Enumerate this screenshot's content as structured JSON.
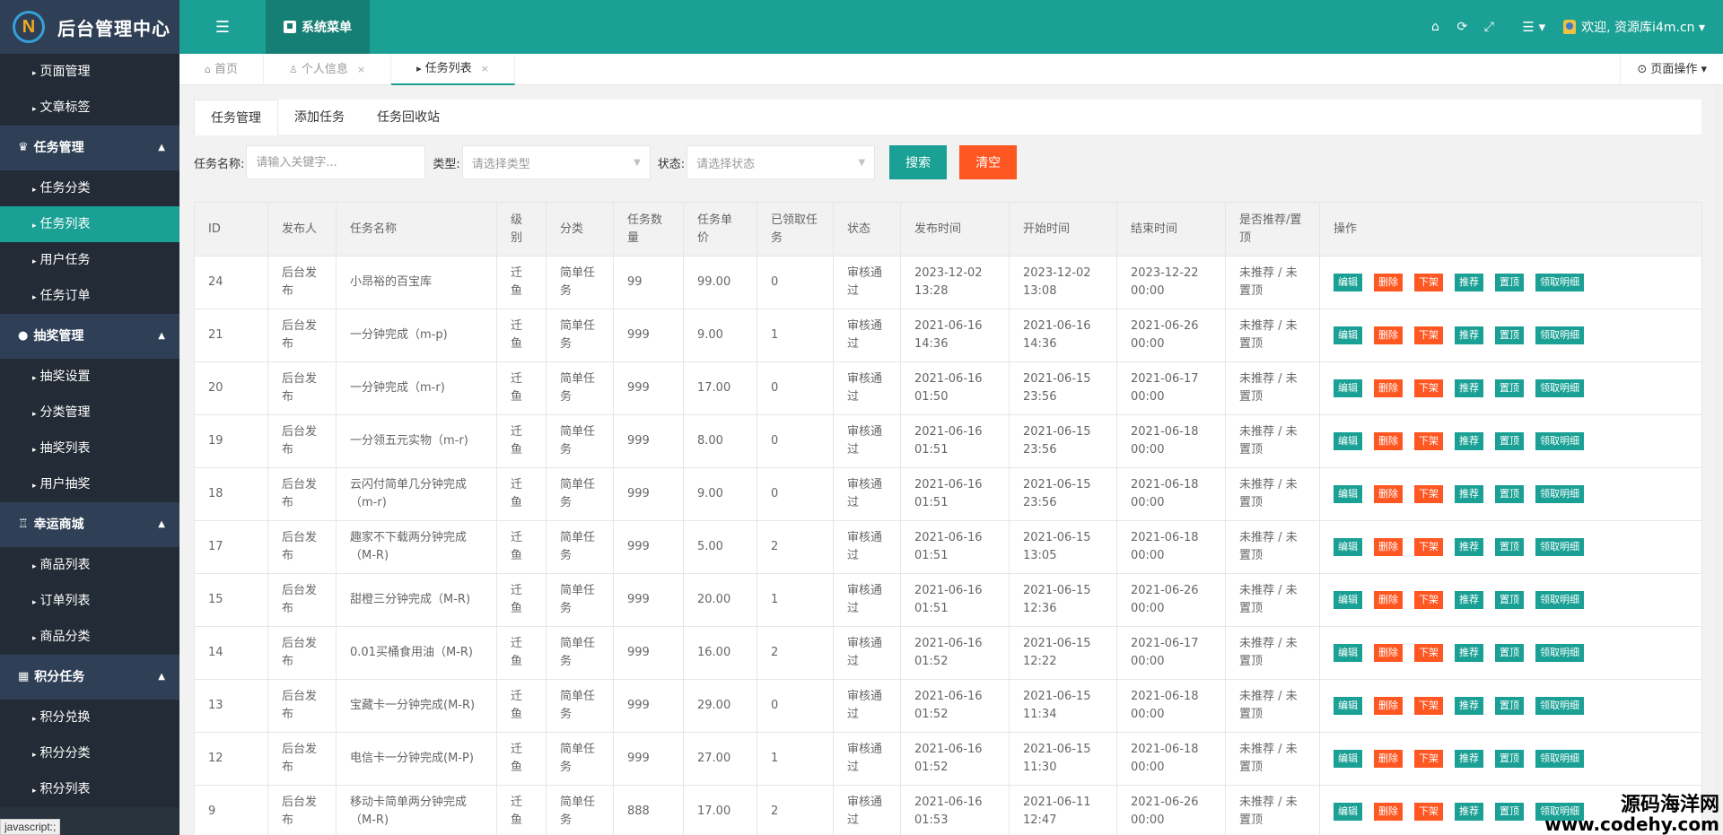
{
  "header": {
    "logo_letter": "N",
    "title": "后台管理中心",
    "menu_toggle": "☰",
    "system_menu": "系统菜单",
    "home_icon": "⌂",
    "refresh_icon": "⟳",
    "fullscreen_icon": "⤢",
    "list_icon": "☰ ▾",
    "user": "欢迎, 资源库i4m.cn ▾"
  },
  "sidebar": {
    "top_items": [
      "页面管理",
      "文章标签"
    ],
    "groups": [
      {
        "icon": "♛",
        "label": "任务管理",
        "items": [
          "任务分类",
          "任务列表",
          "用户任务",
          "任务订单"
        ],
        "active": 1
      },
      {
        "icon": "●",
        "label": "抽奖管理",
        "items": [
          "抽奖设置",
          "分类管理",
          "抽奖列表",
          "用户抽奖"
        ]
      },
      {
        "icon": "♖",
        "label": "幸运商城",
        "items": [
          "商品列表",
          "订单列表",
          "商品分类"
        ]
      },
      {
        "icon": "▦",
        "label": "积分任务",
        "items": [
          "积分兑换",
          "积分分类",
          "积分列表"
        ]
      }
    ],
    "status": "javascript:;"
  },
  "tabs": {
    "items": [
      {
        "icon": "⌂",
        "label": "首页",
        "closable": false
      },
      {
        "icon": "♙",
        "label": "个人信息",
        "closable": true
      },
      {
        "icon": "▸",
        "label": "任务列表",
        "closable": true,
        "active": true
      }
    ],
    "close": "×",
    "page_ops": "⊙ 页面操作 ▾"
  },
  "subtabs": [
    "任务管理",
    "添加任务",
    "任务回收站"
  ],
  "filter": {
    "name_label": "任务名称:",
    "name_placeholder": "请输入关键字...",
    "type_label": "类型:",
    "type_placeholder": "请选择类型",
    "status_label": "状态:",
    "status_placeholder": "请选择状态",
    "search": "搜索",
    "clear": "清空"
  },
  "table": {
    "headers": [
      "ID",
      "发布人",
      "任务名称",
      "级别",
      "分类",
      "任务数量",
      "任务单价",
      "已领取任务",
      "状态",
      "发布时间",
      "开始时间",
      "结束时间",
      "是否推荐/置顶",
      "操作"
    ],
    "rows": [
      [
        "24",
        "后台发布",
        "小昂裕的百宝库",
        "迁鱼",
        "简单任务",
        "99",
        "99.00",
        "0",
        "审核通过",
        "2023-12-02 13:28",
        "2023-12-02 13:08",
        "2023-12-22 00:00",
        "未推荐 / 未置顶"
      ],
      [
        "21",
        "后台发布",
        "一分钟完成（m-p)",
        "迁鱼",
        "简单任务",
        "999",
        "9.00",
        "1",
        "审核通过",
        "2021-06-16 14:36",
        "2021-06-16 14:36",
        "2021-06-26 00:00",
        "未推荐 / 未置顶"
      ],
      [
        "20",
        "后台发布",
        "一分钟完成（m-r)",
        "迁鱼",
        "简单任务",
        "999",
        "17.00",
        "0",
        "审核通过",
        "2021-06-16 01:50",
        "2021-06-15 23:56",
        "2021-06-17 00:00",
        "未推荐 / 未置顶"
      ],
      [
        "19",
        "后台发布",
        "一分领五元实物（m-r)",
        "迁鱼",
        "简单任务",
        "999",
        "8.00",
        "0",
        "审核通过",
        "2021-06-16 01:51",
        "2021-06-15 23:56",
        "2021-06-18 00:00",
        "未推荐 / 未置顶"
      ],
      [
        "18",
        "后台发布",
        "云闪付简单几分钟完成（m-r)",
        "迁鱼",
        "简单任务",
        "999",
        "9.00",
        "0",
        "审核通过",
        "2021-06-16 01:51",
        "2021-06-15 23:56",
        "2021-06-18 00:00",
        "未推荐 / 未置顶"
      ],
      [
        "17",
        "后台发布",
        "趣家不下载两分钟完成（M-R)",
        "迁鱼",
        "简单任务",
        "999",
        "5.00",
        "2",
        "审核通过",
        "2021-06-16 01:51",
        "2021-06-15 13:05",
        "2021-06-18 00:00",
        "未推荐 / 未置顶"
      ],
      [
        "15",
        "后台发布",
        "甜橙三分钟完成（M-R)",
        "迁鱼",
        "简单任务",
        "999",
        "20.00",
        "1",
        "审核通过",
        "2021-06-16 01:51",
        "2021-06-15 12:36",
        "2021-06-26 00:00",
        "未推荐 / 未置顶"
      ],
      [
        "14",
        "后台发布",
        "0.01买桶食用油（M-R)",
        "迁鱼",
        "简单任务",
        "999",
        "16.00",
        "2",
        "审核通过",
        "2021-06-16 01:52",
        "2021-06-15 12:22",
        "2021-06-17 00:00",
        "未推荐 / 未置顶"
      ],
      [
        "13",
        "后台发布",
        "宝藏卡一分钟完成(M-R)",
        "迁鱼",
        "简单任务",
        "999",
        "29.00",
        "0",
        "审核通过",
        "2021-06-16 01:52",
        "2021-06-15 11:34",
        "2021-06-18 00:00",
        "未推荐 / 未置顶"
      ],
      [
        "12",
        "后台发布",
        "电信卡一分钟完成(M-P)",
        "迁鱼",
        "简单任务",
        "999",
        "27.00",
        "1",
        "审核通过",
        "2021-06-16 01:52",
        "2021-06-15 11:30",
        "2021-06-18 00:00",
        "未推荐 / 未置顶"
      ],
      [
        "9",
        "后台发布",
        "移动卡简单两分钟完成（M-R)",
        "迁鱼",
        "简单任务",
        "888",
        "17.00",
        "2",
        "审核通过",
        "2021-06-16 01:53",
        "2021-06-11 12:47",
        "2021-06-26 00:00",
        "未推荐 / 未置顶"
      ]
    ],
    "actions": [
      {
        "label": "编辑",
        "color": "#1aa094"
      },
      {
        "label": "删除",
        "color": "#ff5722"
      },
      {
        "label": "下架",
        "color": "#ff5722"
      },
      {
        "label": "推荐",
        "color": "#1aa094"
      },
      {
        "label": "置顶",
        "color": "#1aa094"
      },
      {
        "label": "领取明细",
        "color": "#1aa094"
      }
    ]
  },
  "watermark": {
    "line1": "源码海洋网",
    "line2": "www.codehy.com"
  },
  "colors": {
    "primary": "#1aa094",
    "danger": "#ff5722",
    "sidebar": "#28333e",
    "sidebar_group": "#2f4056"
  }
}
